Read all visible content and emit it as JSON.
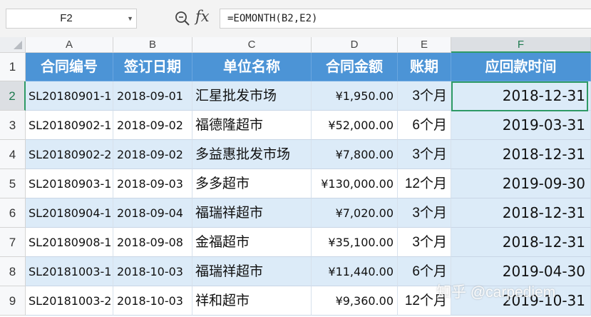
{
  "formula_bar": {
    "name_box": "F2",
    "formula": "=EOMONTH(B2,E2)",
    "fx_label": "fx"
  },
  "columns": [
    "A",
    "B",
    "C",
    "D",
    "E",
    "F"
  ],
  "active_column": "F",
  "rows": [
    "1",
    "2",
    "3",
    "4",
    "5",
    "6",
    "7",
    "8",
    "9"
  ],
  "active_row": "2",
  "table": {
    "headers": [
      "合同编号",
      "签订日期",
      "单位名称",
      "合同金额",
      "账期",
      "应回款时间"
    ],
    "records": [
      [
        "SL20180901-1",
        "2018-09-01",
        "汇星批发市场",
        "¥1,950.00",
        "3个月",
        "2018-12-31"
      ],
      [
        "SL20180902-1",
        "2018-09-02",
        "福德隆超市",
        "¥52,000.00",
        "6个月",
        "2019-03-31"
      ],
      [
        "SL20180902-2",
        "2018-09-02",
        "多益惠批发市场",
        "¥7,800.00",
        "3个月",
        "2018-12-31"
      ],
      [
        "SL20180903-1",
        "2018-09-03",
        "多多超市",
        "¥130,000.00",
        "12个月",
        "2019-09-30"
      ],
      [
        "SL20180904-1",
        "2018-09-04",
        "福瑞祥超市",
        "¥7,020.00",
        "3个月",
        "2018-12-31"
      ],
      [
        "SL20180908-1",
        "2018-09-08",
        "金福超市",
        "¥35,100.00",
        "3个月",
        "2018-12-31"
      ],
      [
        "SL20181003-1",
        "2018-10-03",
        "福瑞祥超市",
        "¥11,440.00",
        "6个月",
        "2019-04-30"
      ],
      [
        "SL20181003-2",
        "2018-10-03",
        "祥和超市",
        "¥9,360.00",
        "12个月",
        "2019-10-31"
      ]
    ]
  },
  "watermark": "知乎 @carpediem",
  "colors": {
    "header_fill": "#4c94d6",
    "band_fill": "#dcebf8",
    "selection": "#2e9a66"
  }
}
